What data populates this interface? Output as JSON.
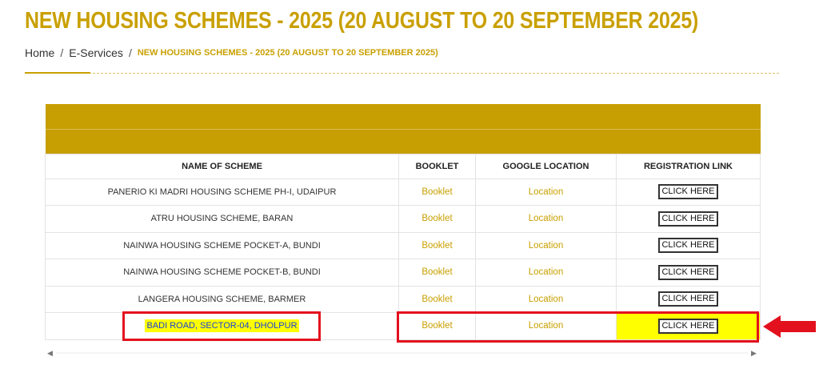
{
  "page": {
    "title": "NEW HOUSING SCHEMES - 2025 (20 AUGUST TO 20 SEPTEMBER 2025)"
  },
  "breadcrumb": {
    "home": "Home",
    "sep1": "/",
    "eservices": "E-Services",
    "sep2": "/",
    "current": "NEW HOUSING SCHEMES - 2025 (20 AUGUST TO 20 SEPTEMBER 2025)"
  },
  "table": {
    "headers": {
      "scheme": "NAME OF SCHEME",
      "booklet": "BOOKLET",
      "location": "GOOGLE LOCATION",
      "registration": "REGISTRATION LINK"
    },
    "rows": [
      {
        "scheme": "PANERIO KI MADRI HOUSING SCHEME PH-I, UDAIPUR",
        "booklet": "Booklet",
        "location": "Location",
        "registration": "CLICK HERE"
      },
      {
        "scheme": "ATRU HOUSING SCHEME, BARAN",
        "booklet": "Booklet",
        "location": "Location",
        "registration": "CLICK HERE"
      },
      {
        "scheme": "NAINWA HOUSING SCHEME POCKET-A, BUNDI",
        "booklet": "Booklet",
        "location": "Location",
        "registration": "CLICK HERE"
      },
      {
        "scheme": "NAINWA HOUSING SCHEME POCKET-B, BUNDI",
        "booklet": "Booklet",
        "location": "Location",
        "registration": "CLICK HERE"
      },
      {
        "scheme": "LANGERA HOUSING SCHEME, BARMER",
        "booklet": "Booklet",
        "location": "Location",
        "registration": "CLICK HERE"
      },
      {
        "scheme": "BADI ROAD, SECTOR-04, DHOLPUR",
        "booklet": "Booklet",
        "location": "Location",
        "registration": "CLICK HERE"
      }
    ]
  },
  "scrollbar": {
    "left_glyph": "◀",
    "right_glyph": "▶"
  },
  "colors": {
    "accent": "#c9a000",
    "band": "#c79f03",
    "highlight": "#ffff00",
    "annotation_red": "#e3101d"
  },
  "icons": {
    "arrow": "red-arrow-left-icon",
    "scroll_left": "scroll-left-icon",
    "scroll_right": "scroll-right-icon"
  }
}
